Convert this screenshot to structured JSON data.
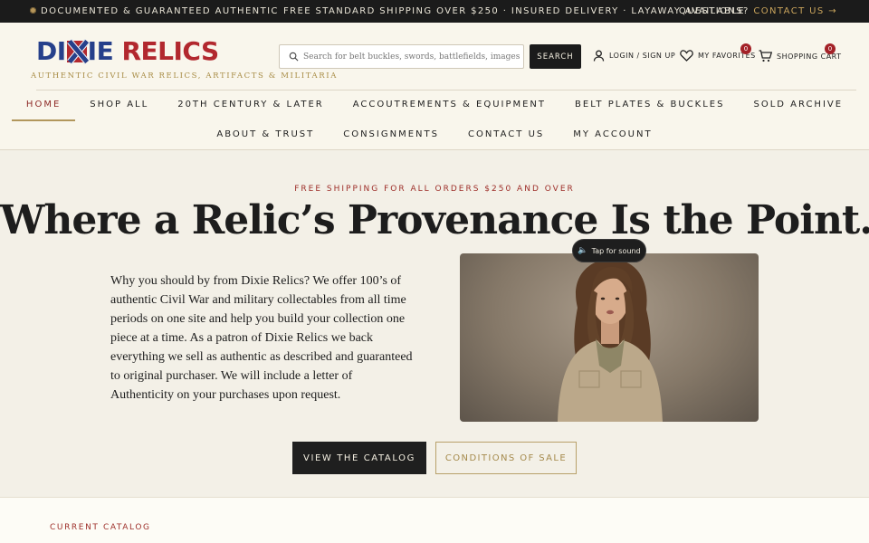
{
  "topbar": {
    "left": "DOCUMENTED & GUARANTEED AUTHENTIC",
    "center": "FREE STANDARD SHIPPING OVER $250 · INSURED DELIVERY · LAYAWAY AVAILABLE",
    "right_prefix": "QUESTIONS?",
    "right_link": "CONTACT US →"
  },
  "brand": {
    "logo_part1": "DI",
    "logo_part2": "IE",
    "logo_part3": "RELICS",
    "tagline": "AUTHENTIC CIVIL WAR RELICS, ARTIFACTS & MILITARIA",
    "colors": {
      "blue": "#26408b",
      "red": "#b2282e",
      "gold": "#a88c45"
    }
  },
  "search": {
    "placeholder": "Search for belt buckles, swords, battlefields, images...",
    "button_label": "SEARCH"
  },
  "utility": {
    "login": "LOGIN / SIGN UP",
    "favorites": "MY FAVORITES",
    "favorites_count": "0",
    "cart": "SHOPPING CART",
    "cart_count": "0"
  },
  "nav": {
    "row1": [
      "HOME",
      "SHOP ALL",
      "20TH CENTURY & LATER",
      "ACCOUTREMENTS & EQUIPMENT",
      "BELT PLATES & BUCKLES",
      "SOLD ARCHIVE"
    ],
    "row2": [
      "ABOUT & TRUST",
      "CONSIGNMENTS",
      "CONTACT US",
      "MY ACCOUNT"
    ],
    "active": "HOME"
  },
  "hero": {
    "eyebrow": "FREE SHIPPING FOR ALL ORDERS $250 AND OVER",
    "headline": "Where a Relic’s Provenance Is the Point.",
    "body": "Why you should by from Dixie Relics? We offer 100’s of authentic Civil War and military collectables from all time periods on one site and help you build your collection one piece at a time. As a patron of Dixie Relics we back everything we sell as authentic as described and guaranteed to original purchaser. We will include a letter of Authenticity on your purchases upon request.",
    "video_sound_label": "Tap for sound",
    "primary_button": "VIEW THE CATALOG",
    "secondary_button": "CONDITIONS OF SALE"
  },
  "catalog": {
    "label": "CURRENT CATALOG"
  }
}
